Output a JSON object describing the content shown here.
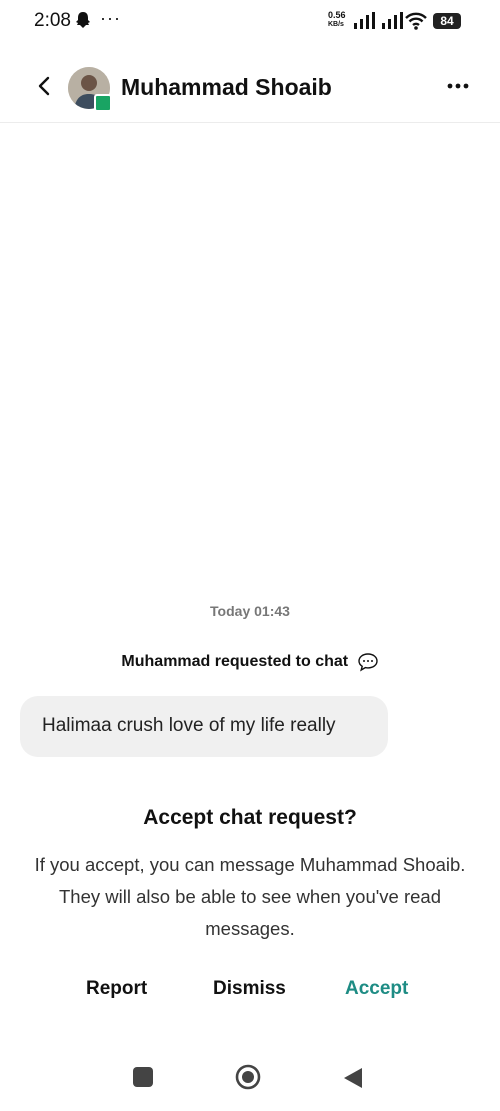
{
  "status_bar": {
    "time": "2:08",
    "more": "···",
    "net_speed_value": "0.56",
    "net_speed_unit": "KB/s",
    "battery": "84"
  },
  "header": {
    "contact_name": "Muhammad Shoaib"
  },
  "chat": {
    "timestamp": "Today 01:43",
    "request_text": "Muhammad requested to chat",
    "message": "Halimaa crush love of my life really"
  },
  "request_prompt": {
    "title": "Accept chat request?",
    "description": "If you accept, you can message Muhammad Shoaib. They will also be able to see when you've read messages.",
    "report_label": "Report",
    "dismiss_label": "Dismiss",
    "accept_label": "Accept"
  },
  "colors": {
    "accent": "#1e8c84",
    "bubble": "#f0f0f0",
    "badge": "#19a463"
  },
  "icons": [
    "ghost-icon",
    "signal-icon",
    "wifi-icon",
    "back-arrow-icon",
    "more-icon",
    "chat-bubble-icon",
    "recent-apps-icon",
    "home-icon",
    "nav-back-icon"
  ]
}
